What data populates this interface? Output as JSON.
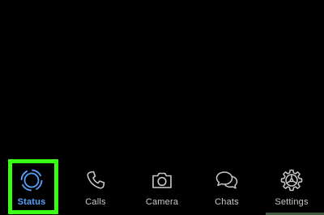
{
  "tab_bar": {
    "tabs": [
      {
        "id": "status",
        "label": "Status",
        "icon": "status-ring-icon",
        "active": true
      },
      {
        "id": "calls",
        "label": "Calls",
        "icon": "phone-icon",
        "active": false
      },
      {
        "id": "camera",
        "label": "Camera",
        "icon": "camera-icon",
        "active": false
      },
      {
        "id": "chats",
        "label": "Chats",
        "icon": "chat-bubbles-icon",
        "active": false
      },
      {
        "id": "settings",
        "label": "Settings",
        "icon": "gear-icon",
        "active": false
      }
    ]
  },
  "colors": {
    "background": "#000000",
    "active_tab": "#5aa0ff",
    "inactive_tab": "#c8c8c8",
    "highlight": "#39ff14"
  }
}
